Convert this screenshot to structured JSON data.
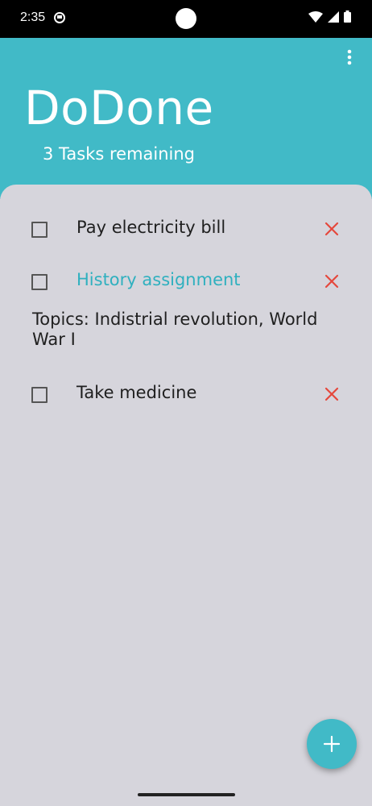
{
  "status_bar": {
    "time": "2:35"
  },
  "header": {
    "title": "DoDone",
    "subtitle": "3 Tasks remaining"
  },
  "tasks": [
    {
      "label": "Pay electricity bill",
      "checked": false,
      "accent": false
    },
    {
      "label": "History assignment",
      "checked": false,
      "accent": true,
      "note": "Topics: Indistrial revolution, World War I"
    },
    {
      "label": "Take medicine",
      "checked": false,
      "accent": false
    }
  ],
  "colors": {
    "primary": "#41bac7",
    "accent_text": "#2fb0bf",
    "delete": "#e5483c",
    "background": "#d6d5dc"
  },
  "icons": {
    "menu": "more-vert-icon",
    "delete": "close-icon",
    "add": "plus-icon",
    "check": "checkbox-outline-icon"
  }
}
